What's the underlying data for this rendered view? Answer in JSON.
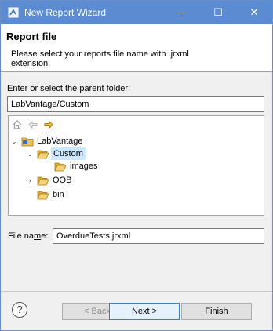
{
  "window": {
    "title": "New Report Wizard",
    "minimize_glyph": "—",
    "maximize_glyph": "☐",
    "close_glyph": "✕"
  },
  "header": {
    "title": "Report file",
    "message": "Please select your reports file name with .jrxml extension."
  },
  "folder": {
    "label": "Enter or select the parent folder:",
    "value": "LabVantage/Custom"
  },
  "tree": {
    "nodes": [
      {
        "label": "LabVantage",
        "expanded": true,
        "level": 0
      },
      {
        "label": "Custom",
        "expanded": true,
        "selected": true,
        "level": 1
      },
      {
        "label": "images",
        "level": 2
      },
      {
        "label": "OOB",
        "expanded": false,
        "level": 1
      },
      {
        "label": "bin",
        "level": 1
      }
    ]
  },
  "file": {
    "label_pre": "File na",
    "label_ul": "m",
    "label_post": "e:",
    "value": "OverdueTests.jrxml"
  },
  "buttons": {
    "help": "?",
    "back_pre": "< ",
    "back_ul": "B",
    "back_post": "ack",
    "next_ul": "N",
    "next_post": "ext >",
    "finish_ul": "F",
    "finish_post": "inish"
  },
  "colors": {
    "titlebar": "#5b8bd0",
    "selection": "#cce8ff",
    "folder": "#e8c25a"
  }
}
